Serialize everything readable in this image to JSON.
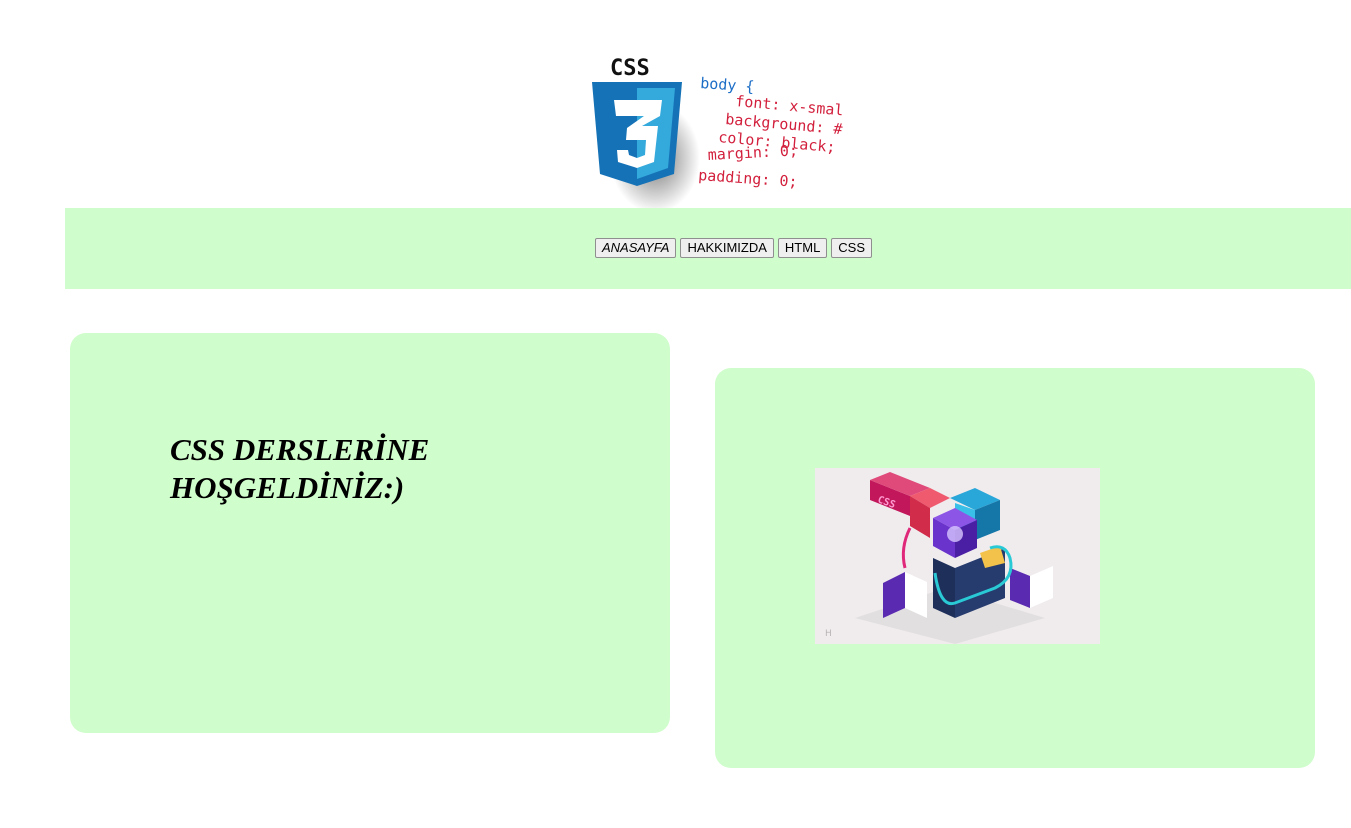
{
  "header": {
    "logo_label": "CSS",
    "logo_number": "3",
    "code_lines": [
      "body {",
      "font: x-smal",
      "background: #",
      "color: black;",
      "margin: 0;",
      "padding: 0;"
    ]
  },
  "nav": {
    "buttons": [
      {
        "label": "ANASAYFA"
      },
      {
        "label": "HAKKIMIZDA"
      },
      {
        "label": "HTML"
      },
      {
        "label": "CSS"
      }
    ],
    "background": "#d0fdcc"
  },
  "main": {
    "welcome_text": "CSS DERSLERİNE HOŞGELDİNİZ:)",
    "art_label": "CSS",
    "card_color": "#d0fdcc"
  }
}
